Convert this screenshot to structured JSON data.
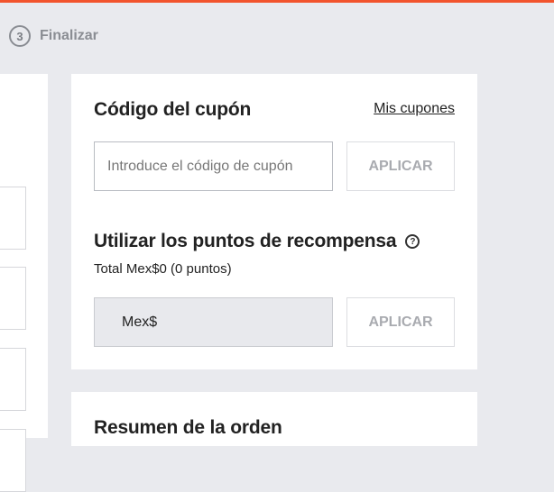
{
  "steps": {
    "current": {
      "number": "3",
      "label": "Finalizar"
    }
  },
  "coupon": {
    "title": "Código del cupón",
    "my_coupons_link": "Mis cupones",
    "input_placeholder": "Introduce el código de cupón",
    "apply_label": "APLICAR"
  },
  "rewards": {
    "title": "Utilizar los puntos de recompensa",
    "total_text": "Total Mex$0 (0 puntos)",
    "currency_prefix": "Mex$",
    "apply_label": "APLICAR"
  },
  "summary": {
    "title": "Resumen de la orden"
  },
  "colors": {
    "accent": "#f2542d",
    "background": "#e9eaee",
    "muted_text": "#8a8d93"
  },
  "icons": {
    "help": "question-circle-icon"
  }
}
